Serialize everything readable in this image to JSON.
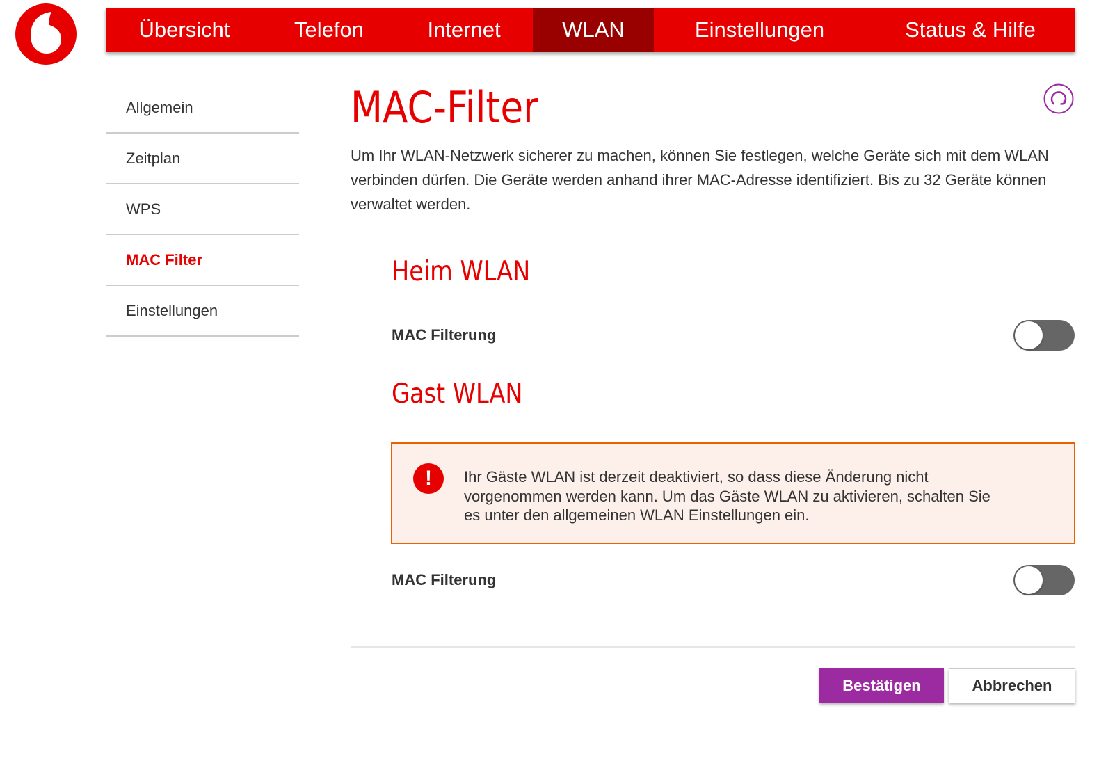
{
  "brand": {
    "accent": "#e60000",
    "nav_active": "#990000",
    "primary_button": "#9c2aa0",
    "alert_border": "#eb6100"
  },
  "logo": {
    "icon": "vodafone-logo-icon"
  },
  "nav": {
    "items": [
      {
        "label": "Übersicht"
      },
      {
        "label": "Telefon"
      },
      {
        "label": "Internet"
      },
      {
        "label": "WLAN",
        "active": true
      },
      {
        "label": "Einstellungen"
      },
      {
        "label": "Status & Hilfe"
      }
    ]
  },
  "sidebar": {
    "items": [
      {
        "label": "Allgemein"
      },
      {
        "label": "Zeitplan"
      },
      {
        "label": "WPS"
      },
      {
        "label": "MAC Filter",
        "active": true
      },
      {
        "label": "Einstellungen"
      }
    ]
  },
  "main": {
    "title": "MAC-Filter",
    "refresh_icon": "refresh-icon",
    "intro": "Um Ihr WLAN-Netzwerk sicherer zu machen, können Sie festlegen, welche Geräte sich mit dem WLAN verbinden dürfen. Die Geräte werden anhand ihrer MAC-Adresse identifiziert. Bis zu 32 Geräte können verwaltet werden."
  },
  "heim": {
    "title": "Heim WLAN",
    "filter_label": "MAC Filterung",
    "filter_on": false
  },
  "gast": {
    "title": "Gast WLAN",
    "alert_icon": "!",
    "alert_text": "Ihr Gäste WLAN ist derzeit deaktiviert, so dass diese Änderung nicht vorgenommen werden kann. Um das Gäste WLAN zu aktivieren, schalten Sie es unter den allgemeinen WLAN Einstellungen ein.",
    "filter_label": "MAC Filterung",
    "filter_on": false
  },
  "actions": {
    "confirm_label": "Bestätigen",
    "cancel_label": "Abbrechen"
  }
}
